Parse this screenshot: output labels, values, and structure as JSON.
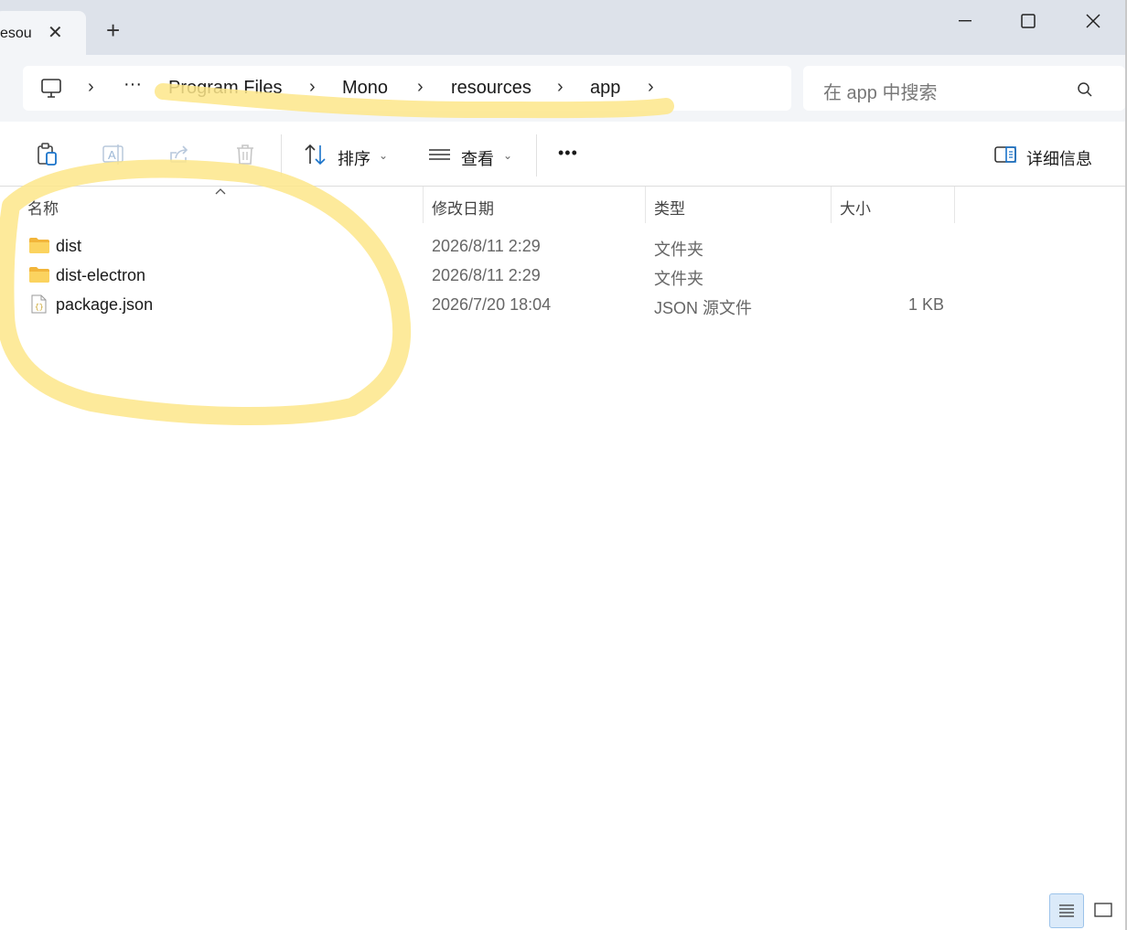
{
  "tab": {
    "title": "esou",
    "close_icon": "close-icon",
    "new_tab_icon": "plus-icon"
  },
  "window_controls": {
    "minimize": "minimize-icon",
    "maximize": "maximize-icon",
    "close": "close-icon"
  },
  "breadcrumb": {
    "items": [
      "Program Files",
      "Mono",
      "resources",
      "app"
    ],
    "overflow": "···"
  },
  "search": {
    "placeholder": "在 app 中搜索",
    "icon": "search-icon"
  },
  "toolbar": {
    "sort_label": "排序",
    "view_label": "查看",
    "more_label": "•••",
    "details_label": "详细信息"
  },
  "columns": {
    "name": "名称",
    "modified": "修改日期",
    "type": "类型",
    "size": "大小"
  },
  "files": [
    {
      "name": "dist",
      "modified": "2026/8/11 2:29",
      "type": "文件夹",
      "size": "",
      "icon": "folder-icon"
    },
    {
      "name": "dist-electron",
      "modified": "2026/8/11 2:29",
      "type": "文件夹",
      "size": "",
      "icon": "folder-icon"
    },
    {
      "name": "package.json",
      "modified": "2026/7/20 18:04",
      "type": "JSON 源文件",
      "size": "1 KB",
      "icon": "json-file-icon"
    }
  ],
  "colors": {
    "highlight": "#fde68a",
    "folder": "#f8c84a",
    "accent": "#1a73c9"
  }
}
